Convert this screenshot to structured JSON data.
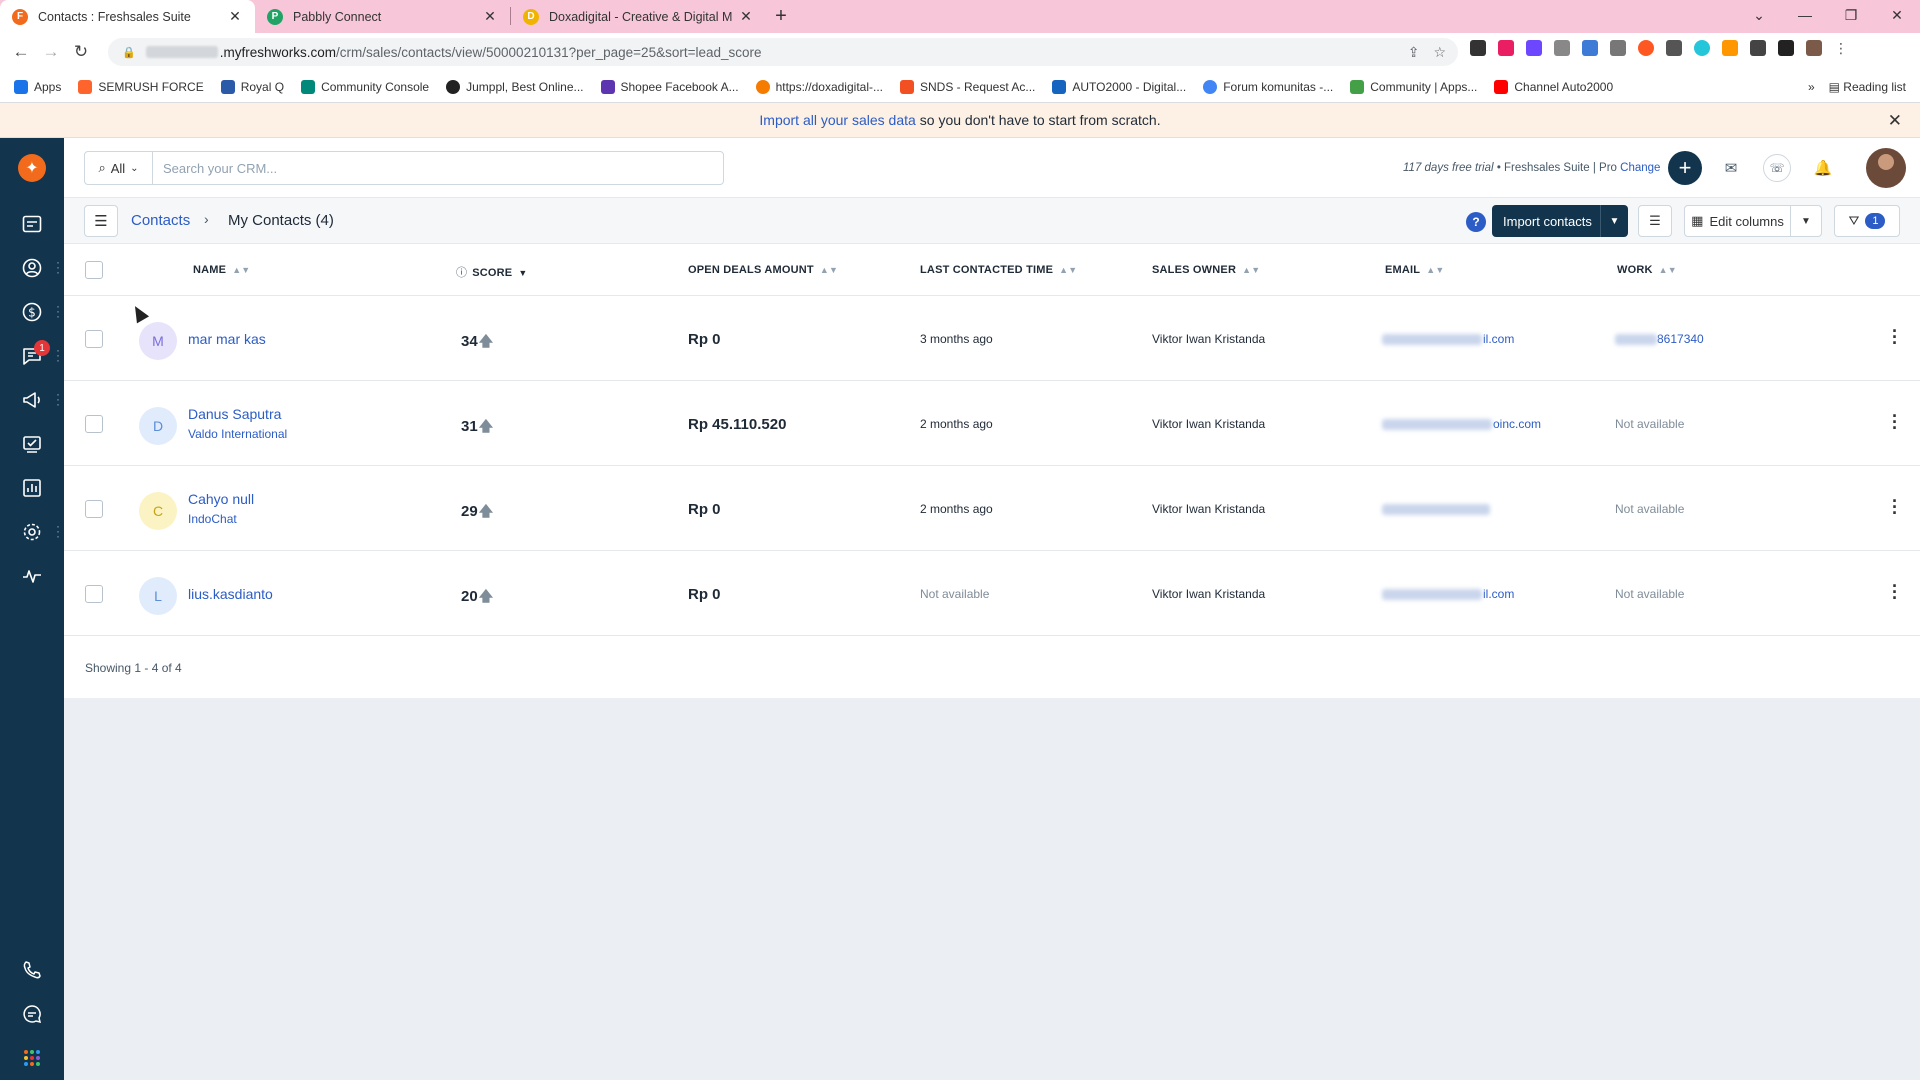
{
  "browser": {
    "tabs": [
      {
        "title": "Contacts : Freshsales Suite",
        "active": true,
        "favicon_color": "#f26a1b",
        "favicon_letter": "F"
      },
      {
        "title": "Pabbly Connect",
        "active": false,
        "favicon_color": "#21a366",
        "favicon_letter": "P"
      },
      {
        "title": "Doxadigital - Creative & Digital M",
        "active": false,
        "favicon_color": "#f0b400",
        "favicon_letter": "D"
      }
    ],
    "url_domain": ".myfreshworks.com",
    "url_path": "/crm/sales/contacts/view/50000210131?per_page=25&sort=lead_score",
    "bookmarks": [
      {
        "label": "Apps",
        "color": "#1a73e8"
      },
      {
        "label": "SEMRUSH FORCE",
        "color": "#ff642d"
      },
      {
        "label": "Royal Q",
        "color": "#2b5aa8"
      },
      {
        "label": "Community Console",
        "color": "#00897b"
      },
      {
        "label": "Jumppl, Best Online...",
        "color": "#222222"
      },
      {
        "label": "Shopee Facebook A...",
        "color": "#5e35b1"
      },
      {
        "label": "https://doxadigital-...",
        "color": "#f57c00"
      },
      {
        "label": "SNDS - Request Ac...",
        "color": "#f25022"
      },
      {
        "label": "AUTO2000 - Digital...",
        "color": "#1565c0"
      },
      {
        "label": "Forum komunitas -...",
        "color": "#4285f4"
      },
      {
        "label": "Community | Apps...",
        "color": "#43a047"
      },
      {
        "label": "Channel Auto2000",
        "color": "#ff0000"
      }
    ],
    "reading_list": "Reading list",
    "more_bookmarks": "»"
  },
  "banner": {
    "link_text": "Import all your sales data",
    "rest_text": "so you don't have to start from scratch."
  },
  "search": {
    "scope": "All",
    "placeholder": "Search your CRM..."
  },
  "topbar": {
    "trial_text": "117 days free trial",
    "plan_text": "Freshsales Suite | Pro",
    "change_link": "Change"
  },
  "notifications_badge": "1",
  "breadcrumb": {
    "root": "Contacts",
    "current": "My Contacts (4)"
  },
  "actions": {
    "import_label": "Import contacts",
    "edit_columns_label": "Edit columns",
    "filter_count": "1"
  },
  "columns": {
    "name": "NAME",
    "score": "SCORE",
    "deals": "OPEN DEALS AMOUNT",
    "last_contacted": "LAST CONTACTED TIME",
    "owner": "SALES OWNER",
    "email": "EMAIL",
    "work": "WORK"
  },
  "rows": [
    {
      "initial": "M",
      "avatar_bg": "#e6e3fb",
      "avatar_fg": "#7b6fd6",
      "name": "mar mar kas",
      "company": "",
      "score": "34",
      "deals": "Rp 0",
      "last_contacted": "3 months ago",
      "owner": "Viktor Iwan Kristanda",
      "email_suffix": "il.com",
      "work_suffix": "8617340"
    },
    {
      "initial": "D",
      "avatar_bg": "#e0ecfc",
      "avatar_fg": "#5b8dd9",
      "name": "Danus Saputra",
      "company": "Valdo International",
      "score": "31",
      "deals": "Rp 45.110.520",
      "last_contacted": "2 months ago",
      "owner": "Viktor Iwan Kristanda",
      "email_suffix": "oinc.com",
      "work_suffix": "Not available"
    },
    {
      "initial": "C",
      "avatar_bg": "#fbf3c4",
      "avatar_fg": "#c7a414",
      "name": "Cahyo null",
      "company": "IndoChat",
      "score": "29",
      "deals": "Rp 0",
      "last_contacted": "2 months ago",
      "owner": "Viktor Iwan Kristanda",
      "email_suffix": "",
      "work_suffix": "Not available"
    },
    {
      "initial": "L",
      "avatar_bg": "#e0ecfc",
      "avatar_fg": "#5b8dd9",
      "name": "lius.kasdianto",
      "company": "",
      "score": "20",
      "deals": "Rp 0",
      "last_contacted": "Not available",
      "owner": "Viktor Iwan Kristanda",
      "email_suffix": "il.com",
      "work_suffix": "Not available"
    }
  ],
  "footer": {
    "showing": "Showing 1 - 4 of 4"
  },
  "colors": {
    "nav_bg": "#12344d",
    "link": "#2c5cc5",
    "brand_orange": "#f26a1b",
    "badge_red": "#e43538"
  }
}
